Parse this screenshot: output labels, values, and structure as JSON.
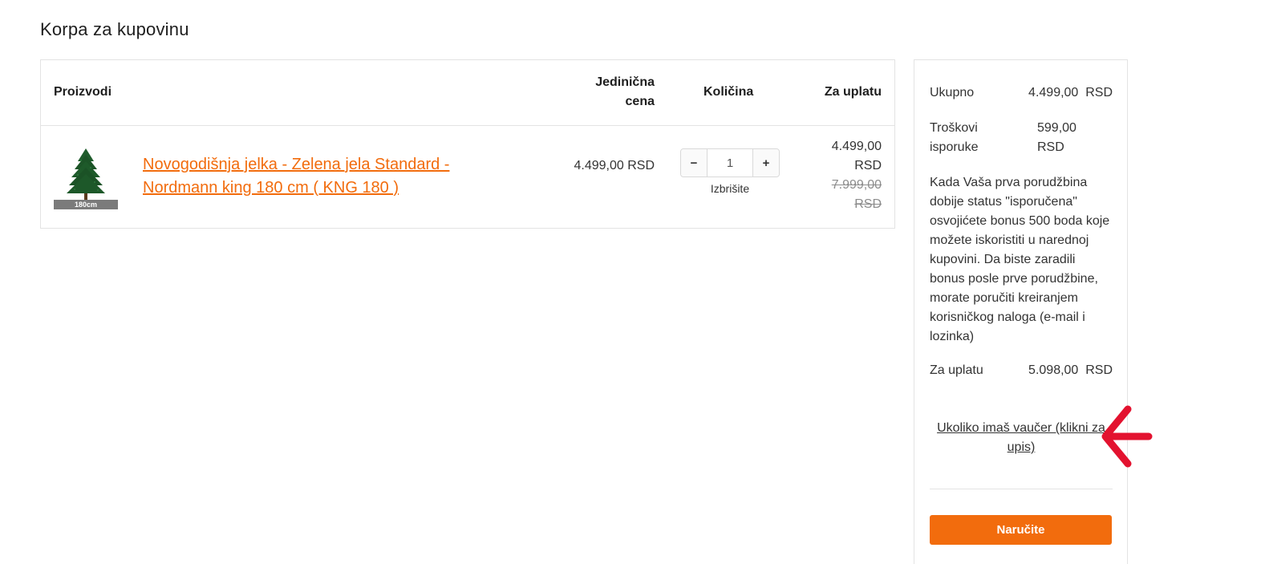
{
  "page": {
    "title": "Korpa za kupovinu"
  },
  "table": {
    "headers": {
      "products": "Proizvodi",
      "unit_price": "Jedinična cena",
      "quantity": "Količina",
      "total": "Za uplatu"
    },
    "items": [
      {
        "name": "Novogodišnja jelka - Zelena jela Standard - Nordmann king 180 cm ( KNG 180 )",
        "thumb_badge": "180cm",
        "unit_price": "4.499,00 RSD",
        "quantity": "1",
        "remove_label": "Izbrišite",
        "total": "4.499,00 RSD",
        "old_total": "7.999,00 RSD"
      }
    ]
  },
  "summary": {
    "subtotal_label": "Ukupno",
    "subtotal_value": "4.499,00  RSD",
    "shipping_label": "Troškovi isporuke",
    "shipping_value": "599,00 RSD",
    "bonus_text": "Kada Vaša prva porudžbina dobije status \"isporučena\" osvojićete bonus 500 boda koje možete iskoristiti u narednoj kupovini. Da biste zaradili bonus posle prve porudžbine, morate poručiti kreiranjem korisničkog naloga (e-mail i lozinka)",
    "total_label": "Za uplatu",
    "total_value": "5.098,00  RSD",
    "voucher_link": "Ukoliko imaš vaučer (klikni za upis)",
    "order_button": "Naručite"
  },
  "icons": {
    "minus": "minus-icon",
    "plus": "plus-icon",
    "arrow": "red-arrow-icon"
  },
  "colors": {
    "accent": "#f26c0d",
    "annotation_arrow": "#e3122f"
  }
}
